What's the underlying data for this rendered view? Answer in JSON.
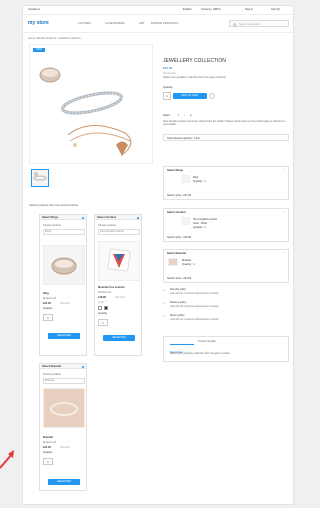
{
  "topbar": {
    "contact": "Contact us",
    "lang": "English",
    "currency": "Currency: GBP £",
    "signin": "Sign in",
    "cart": "Cart (0)"
  },
  "nav": {
    "logo": "my store",
    "links": [
      "CLOTHES",
      "ACCESSORIES",
      "ART",
      "BUNDLE PRODUCTS"
    ],
    "search_placeholder": "Search our catalog"
  },
  "breadcrumb": "Home / Bundle Products / Jewellery collection",
  "product": {
    "badge": "NEW",
    "title": "JEWELLERY COLLECTION",
    "price": "£95.96",
    "tax": "Tax included",
    "short_desc": "Select your jewellery collection from the given sections",
    "qty_label": "Quantity",
    "qty_value": "1",
    "add_to_cart": "ADD TO CART",
    "share_label": "Share",
    "note": "Note: Bundle products cannot be ordered from the wishlist. Please choose them on the product page to add them to your wishlist.",
    "total_selected": "Total selected quantity : 3 pcs"
  },
  "select_heading": "Select products from the sections below",
  "sections": [
    {
      "title": "Select Rings",
      "choose": "Choose product",
      "select_value": "Rings",
      "product_name": "Ring",
      "attr": "Product unit",
      "price": "£61.00",
      "old_price": "(Tax incl.)",
      "qty_label": "Quantity",
      "qty": "1",
      "btn": "SELECTED"
    },
    {
      "title": "Select Cushion",
      "choose": "Choose product",
      "select_value": "Hummingbird cushion",
      "product_name": "Mountain fox cushion",
      "attr": "Product unit",
      "price": "£18.96",
      "old_price": "(Tax incl.)",
      "color_label": "Color",
      "qty_label": "Quantity",
      "qty": "1",
      "btn": "SELECTED"
    },
    {
      "title": "Select Bracelet",
      "choose": "Choose product",
      "select_value": "Bracelet",
      "product_name": "Bracelet",
      "attr": "Product unit",
      "price": "£61.00",
      "old_price": "(Tax incl.)",
      "qty_label": "Quantity",
      "qty": "1",
      "btn": "SELECTED"
    }
  ],
  "summary": [
    {
      "title": "Select Rings",
      "item": "Ring",
      "qty": "Quantity : 1",
      "sub": "Section price : £61.00"
    },
    {
      "title": "Select Cushion",
      "item": "Hummingbird cushion",
      "line2": "Color : White",
      "qty": "Quantity : 1",
      "sub": "Section price : £18.96"
    },
    {
      "title": "Select Bracelet",
      "item": "Bracelet",
      "qty": "Quantity : 1",
      "sub": "Section price : £61.00"
    }
  ],
  "policies": [
    {
      "title": "Security policy",
      "text": "(edit with the Customer Reassurance module)"
    },
    {
      "title": "Delivery policy",
      "text": "(edit with the Customer Reassurance module)"
    },
    {
      "title": "Return policy",
      "text": "(edit with the Customer Reassurance module)"
    }
  ],
  "tabs": {
    "description": "Description",
    "details": "Product Details",
    "desc_text": "Select your jewellery collection from the given sections"
  },
  "colors": {
    "accent": "#2196f3",
    "brand": "#1a73c8",
    "warning": "#e08a1e",
    "page_bg": "#eef0f2"
  }
}
